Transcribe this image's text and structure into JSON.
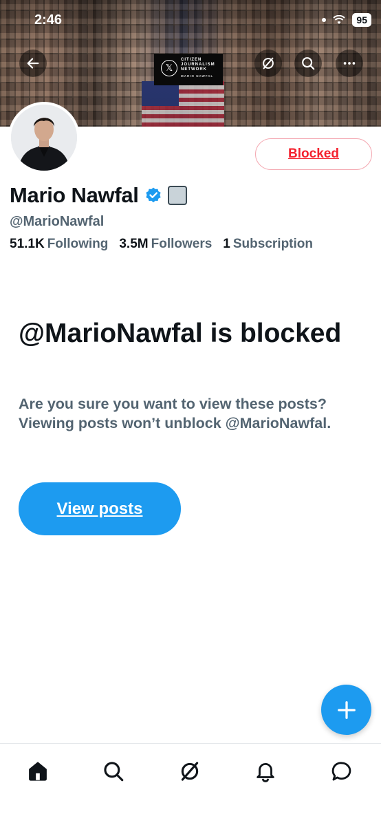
{
  "status_bar": {
    "time": "2:46",
    "battery": "95"
  },
  "header": {
    "banner_logo_lines": [
      "CITIZEN",
      "JOURNALISM",
      "NETWORK"
    ],
    "banner_logo_sub": "MARIO NAWFAL"
  },
  "profile": {
    "display_name": "Mario Nawfal",
    "handle": "@MarioNawfal",
    "relationship_button": "Blocked",
    "stats": [
      {
        "value": "51.1K",
        "label": "Following"
      },
      {
        "value": "3.5M",
        "label": "Followers"
      },
      {
        "value": "1",
        "label": "Subscription"
      }
    ]
  },
  "blocked_notice": {
    "title": "@MarioNawfal is blocked",
    "description": "Are you sure you want to view these posts? Viewing posts won’t unblock @MarioNawfal.",
    "button": "View posts"
  },
  "bottom_nav": [
    "home-icon",
    "search-icon",
    "grok-icon",
    "notifications-icon",
    "messages-icon"
  ],
  "colors": {
    "accent": "#1d9bf0",
    "blocked_red": "#f4212e",
    "text_primary": "#0f1419",
    "text_secondary": "#536471"
  }
}
